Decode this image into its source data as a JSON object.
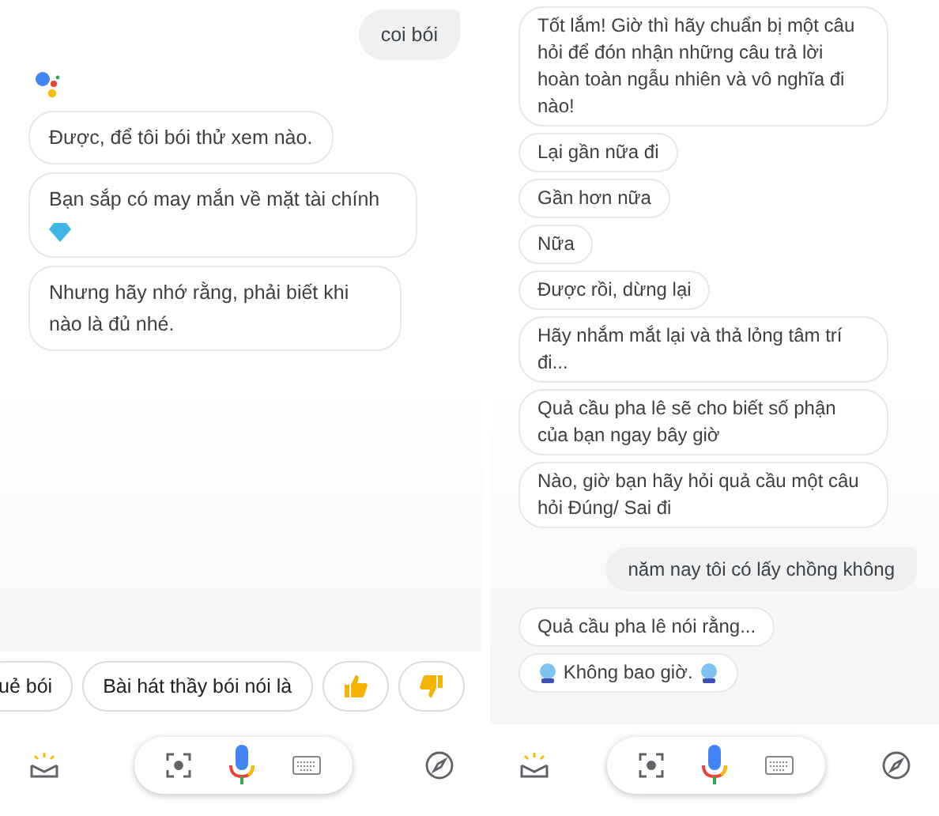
{
  "panels": [
    {
      "messages": [
        {
          "kind": "user",
          "text": "coi bói"
        },
        {
          "kind": "logo"
        },
        {
          "kind": "assistant",
          "text": "Được, để tôi bói thử xem nào."
        },
        {
          "kind": "assistant_gem",
          "text": "Bạn sắp có may mắn về mặt tài chính"
        },
        {
          "kind": "assistant",
          "text": "Nhưng hãy nhớ rằng, phải biết khi nào là đủ nhé."
        }
      ],
      "chips": [
        {
          "kind": "text",
          "label": "uẻ bói"
        },
        {
          "kind": "text",
          "label": "Bài hát thầy bói nói là"
        },
        {
          "kind": "thumbs_up"
        },
        {
          "kind": "thumbs_down"
        }
      ]
    },
    {
      "messages": [
        {
          "kind": "assistant",
          "text": "Tốt lắm! Giờ thì hãy chuẩn bị một câu hỏi để đón nhận những câu trả lời hoàn toàn ngẫu nhiên và vô nghĩa đi nào!"
        },
        {
          "kind": "assistant",
          "text": "Lại gần nữa đi"
        },
        {
          "kind": "assistant",
          "text": "Gần hơn nữa"
        },
        {
          "kind": "assistant",
          "text": "Nữa"
        },
        {
          "kind": "assistant",
          "text": "Được rồi, dừng lại"
        },
        {
          "kind": "assistant",
          "text": "Hãy nhắm mắt lại và thả lỏng tâm trí đi..."
        },
        {
          "kind": "assistant",
          "text": "Quả cầu pha lê sẽ cho biết số phận của bạn ngay bây giờ"
        },
        {
          "kind": "assistant",
          "text": "Nào, giờ bạn hãy hỏi quả cầu một câu hỏi Đúng/ Sai đi"
        },
        {
          "kind": "user",
          "text": "năm nay tôi có lấy chồng không"
        },
        {
          "kind": "assistant",
          "text": "Quả cầu pha lê nói rằng..."
        },
        {
          "kind": "assistant_ball",
          "text": "Không bao giờ."
        }
      ]
    }
  ]
}
